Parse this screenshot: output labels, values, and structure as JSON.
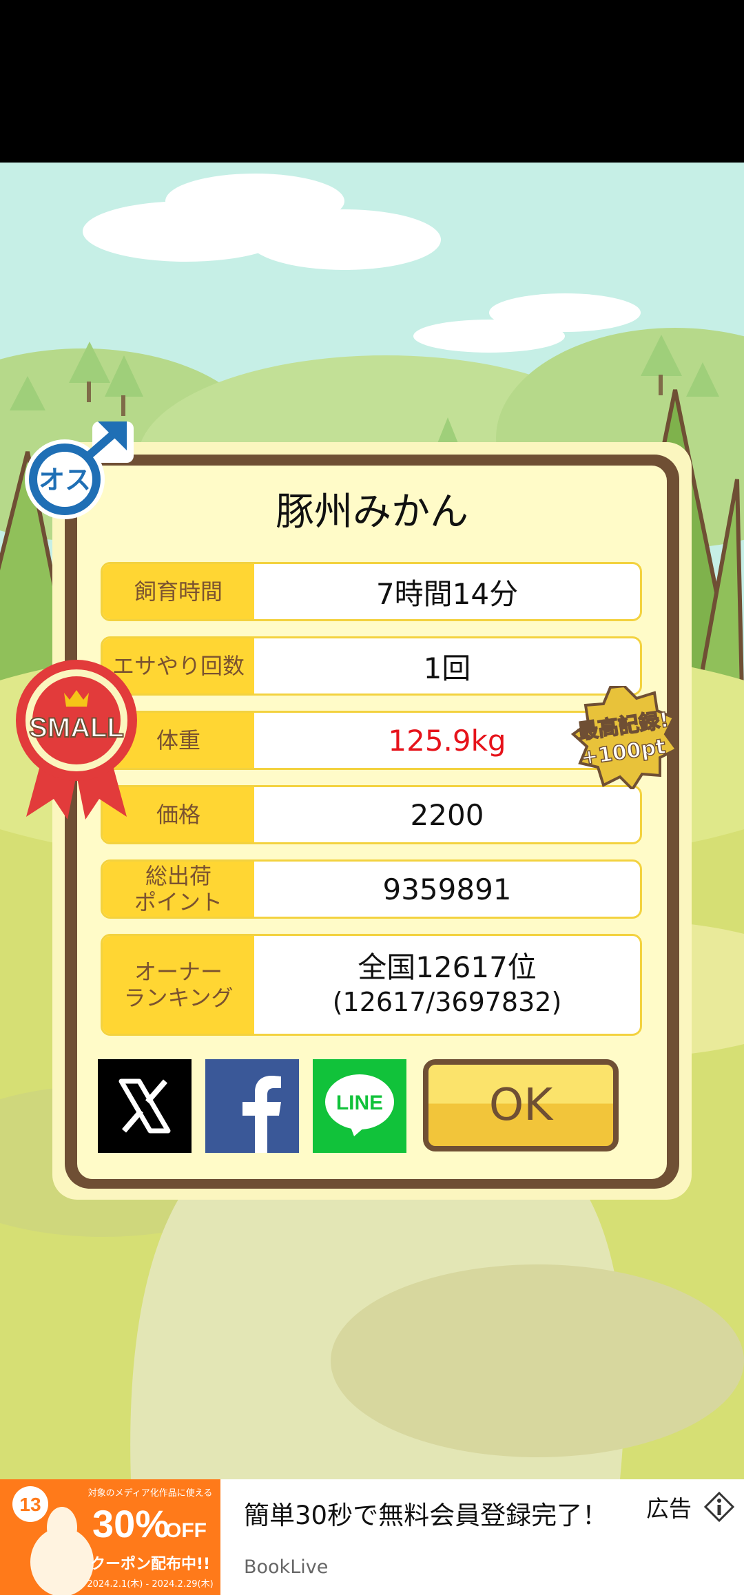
{
  "pig": {
    "name": "豚州みかん",
    "gender_badge": "オス"
  },
  "stats": [
    {
      "label": "飼育時間",
      "value": "7時間14分"
    },
    {
      "label": "エサやり回数",
      "value": "1回"
    },
    {
      "label": "体重",
      "value": "125.9kg"
    },
    {
      "label": "価格",
      "value": "2200"
    },
    {
      "label": "総出荷\nポイント",
      "value": "9359891"
    },
    {
      "label": "オーナー\nランキング",
      "value": "全国12617位",
      "value_sub": "(12617/3697832)"
    }
  ],
  "badges": {
    "size": "SMALL",
    "record_line1": "最高記録!",
    "record_line2": "+100pt"
  },
  "share": {
    "line_label": "LINE"
  },
  "ok_label": "OK",
  "ad": {
    "title": "簡単30秒で無料会員登録完了！",
    "brand": "BookLive",
    "label": "広告",
    "image_text_top": "対象のメディア化作品に使える",
    "image_discount": "30%",
    "image_off": "OFF",
    "image_coupon": "クーポン配布中!!",
    "image_dates": "2024.2.1(木) - 2024.2.29(木)",
    "image_anniv": "13"
  },
  "colors": {
    "modal_border": "#6f4f34",
    "label_bg": "#ffd633",
    "accent_red": "#e6131b"
  },
  "icons": [
    "male-symbol-icon",
    "x-logo-icon",
    "facebook-logo-icon",
    "line-logo-icon",
    "info-icon"
  ]
}
